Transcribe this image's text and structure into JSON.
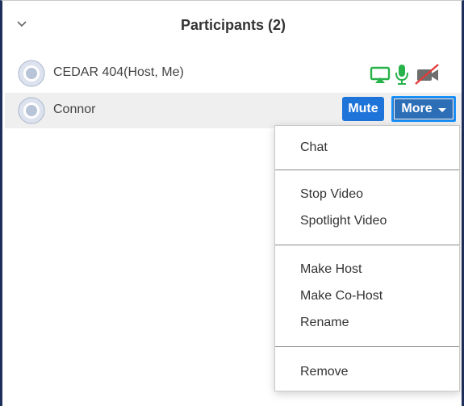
{
  "header": {
    "title": "Participants (2)",
    "collapse_icon": "chevron-down-icon"
  },
  "participants": [
    {
      "name": "CEDAR 404(Host, Me)",
      "avatar_icon": "avatar-icon",
      "status_icons": [
        "screen-share-icon",
        "microphone-icon",
        "video-off-icon"
      ],
      "status_colors": {
        "screen_share": "#27b24a",
        "microphone": "#27b24a",
        "video_off": "#e33b3b"
      }
    },
    {
      "name": "Connor",
      "avatar_icon": "avatar-icon",
      "mute_label": "Mute",
      "more_label": "More"
    }
  ],
  "more_menu": {
    "groups": [
      [
        "Chat"
      ],
      [
        "Stop Video",
        "Spotlight Video"
      ],
      [
        "Make Host",
        "Make Co-Host",
        "Rename"
      ],
      [
        "Remove"
      ]
    ]
  },
  "colors": {
    "accent": "#1e74d9",
    "more_button": "#2c6fb7",
    "row_highlight": "#efefef",
    "frame": "#1f2f5c"
  }
}
